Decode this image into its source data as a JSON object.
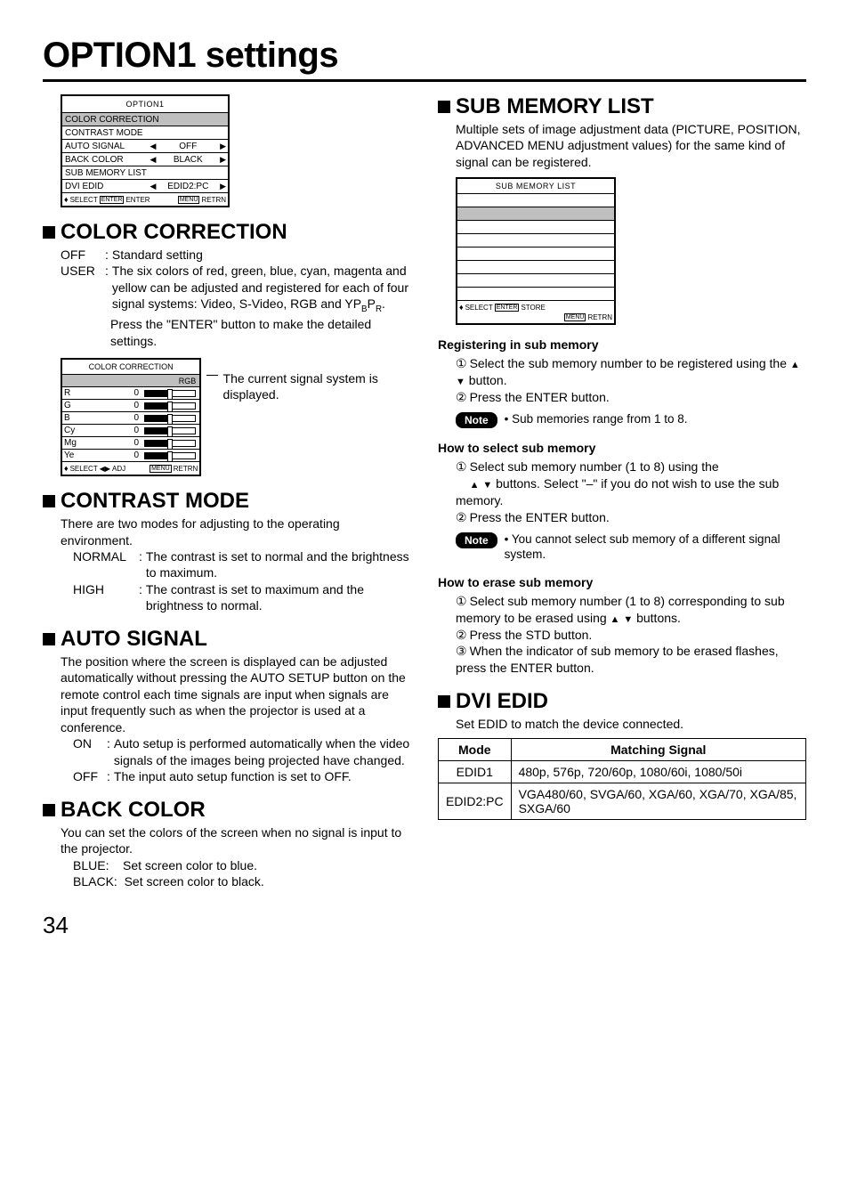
{
  "pageTitle": "OPTION1 settings",
  "pageNumber": "34",
  "osd1": {
    "title": "OPTION1",
    "rows": [
      {
        "label": "COLOR CORRECTION",
        "value": "",
        "hl": true,
        "arrows": false
      },
      {
        "label": "CONTRAST MODE",
        "value": "",
        "hl": false,
        "arrows": false
      },
      {
        "label": "AUTO SIGNAL",
        "value": "OFF",
        "hl": false,
        "arrows": true
      },
      {
        "label": "BACK COLOR",
        "value": "BLACK",
        "hl": false,
        "arrows": true
      },
      {
        "label": "SUB MEMORY LIST",
        "value": "",
        "hl": false,
        "arrows": false
      },
      {
        "label": "DVI EDID",
        "value": "EDID2:PC",
        "hl": false,
        "arrows": true
      }
    ],
    "foot": {
      "select": "SELECT",
      "enterKey": "ENTER",
      "enter": "ENTER",
      "menuKey": "MENU",
      "retrn": "RETRN"
    }
  },
  "colorCorrection": {
    "heading": "COLOR CORRECTION",
    "off_label": "OFF",
    "off_desc": "Standard setting",
    "user_label": "USER",
    "user_desc": "The six colors of red, green, blue, cyan, magenta and yellow can be adjusted and registered for each of four signal systems: Video, S-Video, RGB and YPBPR.",
    "user_desc2": "Press the \"ENTER\" button to make the detailed settings.",
    "osd": {
      "title": "COLOR CORRECTION",
      "signal": "RGB",
      "rows": [
        {
          "label": "R",
          "value": "0"
        },
        {
          "label": "G",
          "value": "0"
        },
        {
          "label": "B",
          "value": "0"
        },
        {
          "label": "Cy",
          "value": "0"
        },
        {
          "label": "Mg",
          "value": "0"
        },
        {
          "label": "Ye",
          "value": "0"
        }
      ],
      "foot": {
        "select": "SELECT",
        "adj": "ADJ",
        "menuKey": "MENU",
        "retrn": "RETRN"
      }
    },
    "annot": "The current signal system is displayed."
  },
  "contrastMode": {
    "heading": "CONTRAST MODE",
    "intro": "There are two modes for adjusting to the operating environment.",
    "normal_label": "NORMAL",
    "normal_desc": "The contrast is set to normal and the brightness to maximum.",
    "high_label": "HIGH",
    "high_desc": "The contrast is set to maximum and the brightness to normal."
  },
  "autoSignal": {
    "heading": "AUTO SIGNAL",
    "intro": "The position where the screen is displayed can be adjusted automatically without pressing the AUTO SETUP button on the remote control each time signals are input when signals are input frequently such as when the projector is used at a conference.",
    "on_label": "ON",
    "on_desc": "Auto setup is performed automatically when the video signals of the images being projected have changed.",
    "off_label": "OFF",
    "off_desc": "The input auto setup function is set to OFF."
  },
  "backColor": {
    "heading": "BACK COLOR",
    "intro": "You can set the colors of the screen when no signal is input to the projector.",
    "blue_label": "BLUE:",
    "blue_desc": "Set screen color to blue.",
    "black_label": "BLACK:",
    "black_desc": "Set screen color to black."
  },
  "subMemory": {
    "heading": "SUB MEMORY LIST",
    "intro": "Multiple sets of image adjustment data (PICTURE, POSITION, ADVANCED MENU adjustment values) for the same kind of signal can be registered.",
    "osd": {
      "title": "SUB MEMORY LIST",
      "foot": {
        "select": "SELECT",
        "enterKey": "ENTER",
        "store": "STORE",
        "menuKey": "MENU",
        "retrn": "RETRN"
      }
    },
    "reg_h": "Registering in sub memory",
    "reg_s1": "Select the sub memory number to be registered using the ",
    "reg_s1b": " button.",
    "reg_s2": "Press the ENTER button.",
    "note1_label": "Note",
    "note1_text": "• Sub memories range from 1 to 8.",
    "sel_h": "How to select sub memory",
    "sel_s1a": "Select sub memory number (1 to 8) using the ",
    "sel_s1b": " buttons. Select \"–\" if you do not wish to use the sub memory.",
    "sel_s2": "Press the ENTER button.",
    "note2_label": "Note",
    "note2_text": "• You cannot select sub memory of a different signal system.",
    "erase_h": "How to erase sub memory",
    "erase_s1a": "Select sub memory number (1 to 8) corresponding to sub memory to be erased using ",
    "erase_s1b": " buttons.",
    "erase_s2": "Press the STD button.",
    "erase_s3": "When the indicator of sub memory to be erased flashes, press the ENTER button."
  },
  "dviEdid": {
    "heading": "DVI EDID",
    "intro": "Set EDID to match the device connected.",
    "th_mode": "Mode",
    "th_sig": "Matching Signal",
    "r1_mode": "EDID1",
    "r1_sig": "480p, 576p, 720/60p, 1080/60i, 1080/50i",
    "r2_mode": "EDID2:PC",
    "r2_sig": "VGA480/60, SVGA/60, XGA/60, XGA/70, XGA/85, SXGA/60"
  }
}
